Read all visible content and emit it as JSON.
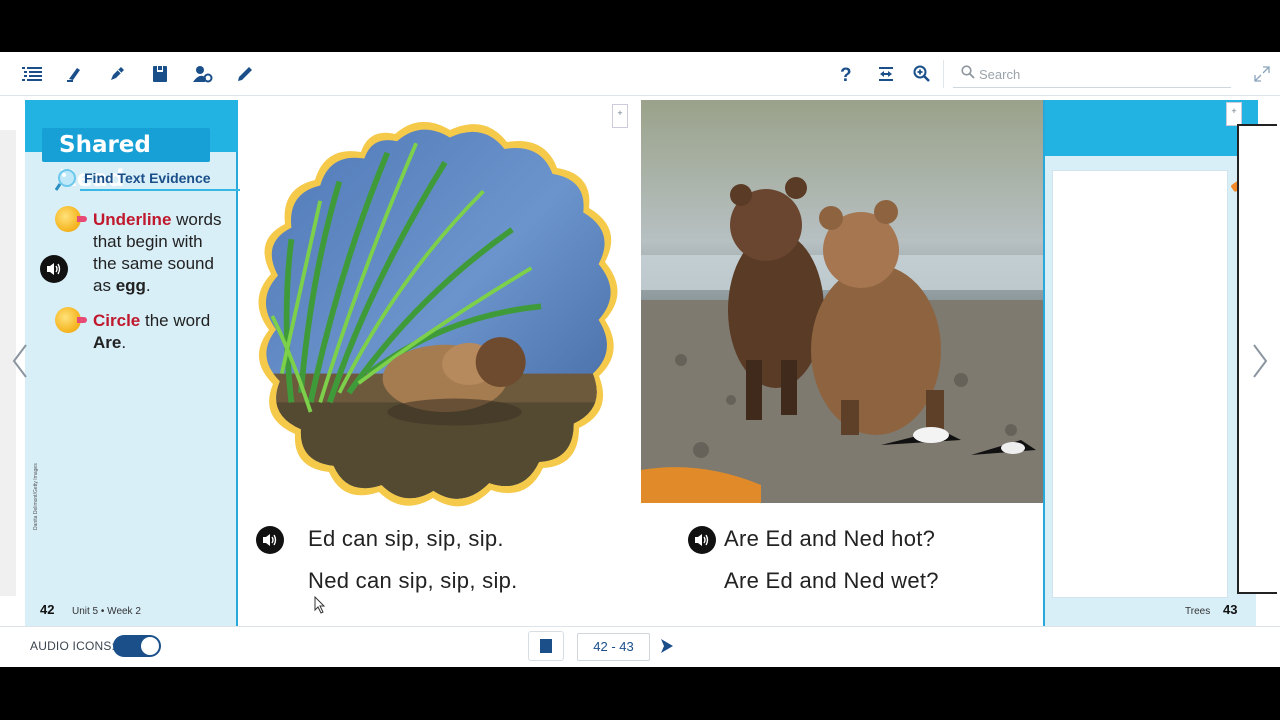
{
  "toolbar": {
    "icons": [
      "list-icon",
      "highlighter-icon",
      "pen-icon",
      "notebook-icon",
      "user-settings-icon",
      "pencil-icon"
    ],
    "right_icons": [
      "help-icon",
      "fit-width-icon",
      "zoom-in-icon"
    ],
    "search_placeholder": "Search",
    "accent": "#1a4f8a"
  },
  "left_page": {
    "heading": "Shared Read",
    "evidence_label": "Find Text Evidence",
    "instruction1_red": "Underline",
    "instruction1_line1_rest": " words",
    "instruction1_line2": "that begin with",
    "instruction1_line3": "the same sound",
    "instruction1_line4_pre": "as ",
    "instruction1_word": "egg",
    "instruction1_line4_post": ".",
    "instruction2_red": "Circle",
    "instruction2_rest": " the word",
    "instruction2_word": "Are",
    "instruction2_post": ".",
    "page_number": "42",
    "unit": "Unit 5 • Week 2",
    "credit": "Danita Delimont/Getty Images"
  },
  "content": {
    "sentence1": "Ed can sip, sip, sip.",
    "sentence2": "Ned can sip, sip, sip.",
    "sentence3": "Are Ed and Ned hot?",
    "sentence4": "Are Ed and Ned wet?",
    "bookmark_left": "+",
    "bookmark_right": "+"
  },
  "right_page": {
    "label": "Trees",
    "page_number": "43"
  },
  "bottom_bar": {
    "audio_label": "AUDIO ICONS:",
    "audio_on": true,
    "page_range": "42 - 43"
  }
}
